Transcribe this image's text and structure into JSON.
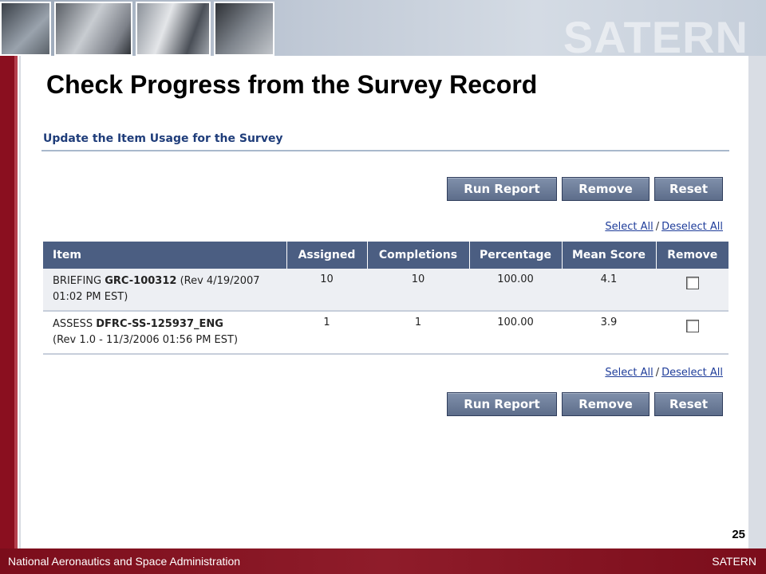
{
  "brand": "SATERN",
  "slide_title": "Check Progress from the Survey Record",
  "section_title": "Update the Item Usage for the Survey",
  "buttons": {
    "run_report": "Run Report",
    "remove": "Remove",
    "reset": "Reset"
  },
  "select_links": {
    "select_all": "Select All",
    "separator": "/",
    "deselect_all": "Deselect All"
  },
  "table": {
    "headers": [
      "Item",
      "Assigned",
      "Completions",
      "Percentage",
      "Mean Score",
      "Remove"
    ],
    "rows": [
      {
        "type": "BRIEFING",
        "code": "GRC-100312",
        "rev": "(Rev 4/19/2007 01:02 PM EST)",
        "assigned": "10",
        "completions": "10",
        "percentage": "100.00",
        "mean_score": "4.1",
        "remove_checked": false
      },
      {
        "type": "ASSESS",
        "code": "DFRC-SS-125937_ENG",
        "rev": "(Rev 1.0 - 11/3/2006 01:56 PM EST)",
        "assigned": "1",
        "completions": "1",
        "percentage": "100.00",
        "mean_score": "3.9",
        "remove_checked": false
      }
    ]
  },
  "page_number": "25",
  "footer": {
    "left": "National Aeronautics and Space Administration",
    "right": "SATERN"
  },
  "colors": {
    "footer_maroon": "#7b0d1b",
    "table_header": "#4b5e82",
    "button": "#6c7c98",
    "link_blue": "#1f3d9a",
    "section_title": "#1f3d7a"
  },
  "icons": {
    "checkbox": "checkbox-icon"
  }
}
